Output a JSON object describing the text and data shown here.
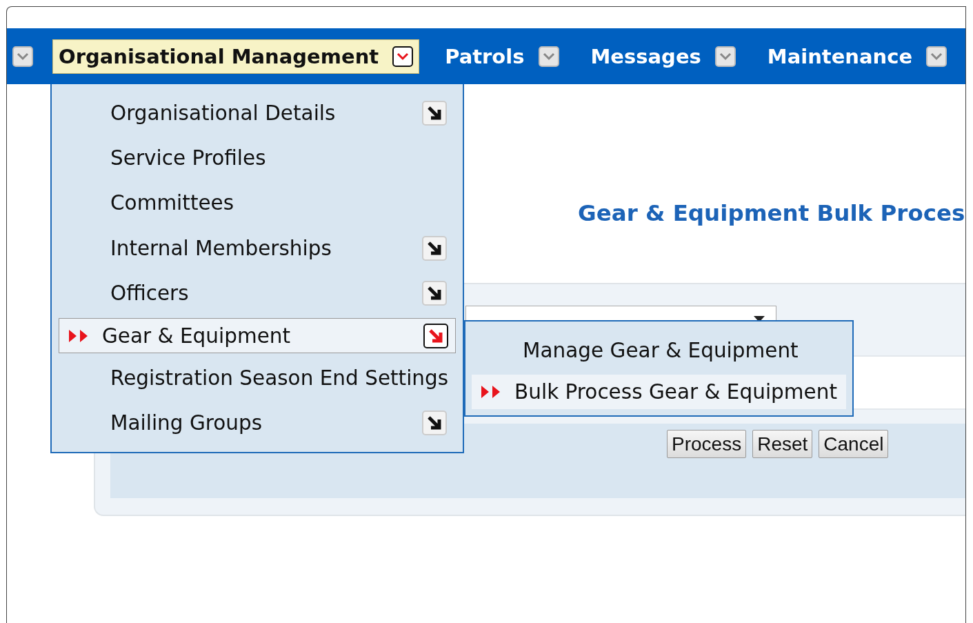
{
  "nav": {
    "items": [
      {
        "label": "Organisational Management",
        "selected": true
      },
      {
        "label": "Patrols",
        "selected": false
      },
      {
        "label": "Messages",
        "selected": false
      },
      {
        "label": "Maintenance",
        "selected": false
      }
    ]
  },
  "menu": {
    "items": [
      {
        "label": "Organisational Details",
        "has_submenu": true,
        "selected": false
      },
      {
        "label": "Service Profiles",
        "has_submenu": false,
        "selected": false
      },
      {
        "label": "Committees",
        "has_submenu": false,
        "selected": false
      },
      {
        "label": "Internal Memberships",
        "has_submenu": true,
        "selected": false
      },
      {
        "label": "Officers",
        "has_submenu": true,
        "selected": false
      },
      {
        "label": "Gear & Equipment",
        "has_submenu": true,
        "selected": true
      },
      {
        "label": "Registration Season End Settings",
        "has_submenu": false,
        "selected": false
      },
      {
        "label": "Mailing Groups",
        "has_submenu": true,
        "selected": false
      }
    ]
  },
  "submenu": {
    "items": [
      {
        "label": "Manage Gear & Equipment",
        "selected": false
      },
      {
        "label": "Bulk Process Gear & Equipment",
        "selected": true
      }
    ]
  },
  "page": {
    "title": "Gear & Equipment Bulk Proces"
  },
  "buttons": [
    "Process",
    "Reset",
    "Cancel"
  ]
}
